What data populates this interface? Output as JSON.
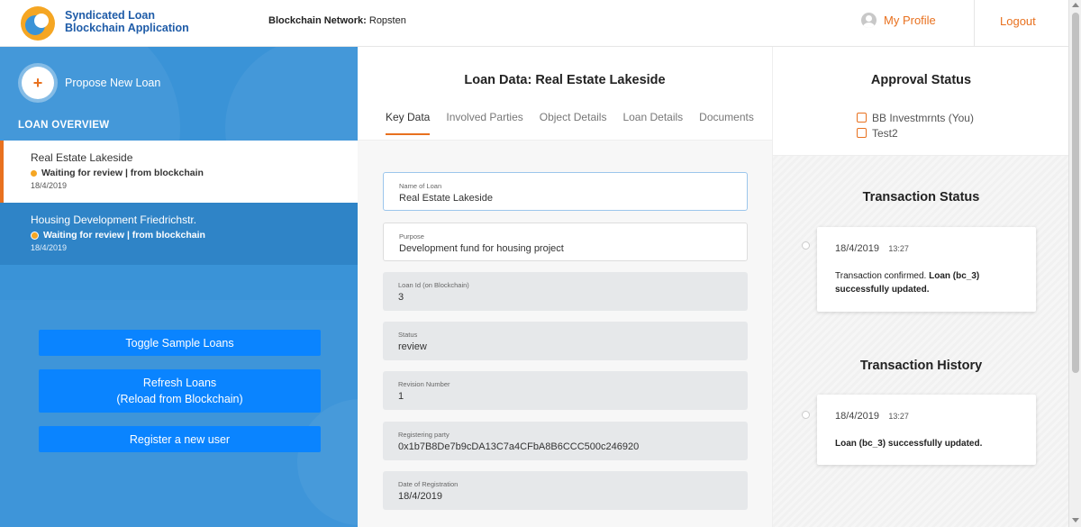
{
  "header": {
    "app_title_line1": "Syndicated Loan",
    "app_title_line2": "Blockchain Application",
    "network_label": "Blockchain Network:",
    "network_value": "Ropsten",
    "profile_label": "My Profile",
    "logout_label": "Logout",
    "accent_color": "#e8711f"
  },
  "sidebar": {
    "propose_icon": "+",
    "propose_label": "Propose New Loan",
    "overview_title": "LOAN OVERVIEW",
    "loans": [
      {
        "name": "Real Estate Lakeside",
        "status": "Waiting for review | from blockchain",
        "date": "18/4/2019"
      },
      {
        "name": "Housing Development Friedrichstr.",
        "status": "Waiting for review | from blockchain",
        "date": "18/4/2019"
      }
    ],
    "buttons": {
      "toggle": "Toggle Sample Loans",
      "refresh_line1": "Refresh Loans",
      "refresh_line2": "(Reload from Blockchain)",
      "register": "Register a new user"
    }
  },
  "main": {
    "title": "Loan Data: Real Estate Lakeside",
    "tabs": [
      "Key Data",
      "Involved Parties",
      "Object Details",
      "Loan Details",
      "Documents"
    ],
    "fields": [
      {
        "label": "Name of Loan",
        "value": "Real Estate Lakeside"
      },
      {
        "label": "Purpose",
        "value": "Development fund for housing project"
      },
      {
        "label": "Loan Id (on Blockchain)",
        "value": "3"
      },
      {
        "label": "Status",
        "value": "review"
      },
      {
        "label": "Revision Number",
        "value": "1"
      },
      {
        "label": "Registering party",
        "value": "0x1b7B8De7b9cDA13C7a4CFbA8B6CCC500c246920"
      },
      {
        "label": "Date of Registration",
        "value": "18/4/2019"
      }
    ]
  },
  "right": {
    "approval_title": "Approval Status",
    "approvers": [
      "BB Investmrnts (You)",
      "Test2"
    ],
    "transaction_status_title": "Transaction Status",
    "transaction_status": {
      "date": "18/4/2019",
      "time": "13:27",
      "text_prefix": "Transaction confirmed. ",
      "text_bold": "Loan (bc_3) successfully updated."
    },
    "transaction_history_title": "Transaction History",
    "transaction_history": {
      "date": "18/4/2019",
      "time": "13:27",
      "text_bold": "Loan (bc_3) successfully updated."
    }
  }
}
